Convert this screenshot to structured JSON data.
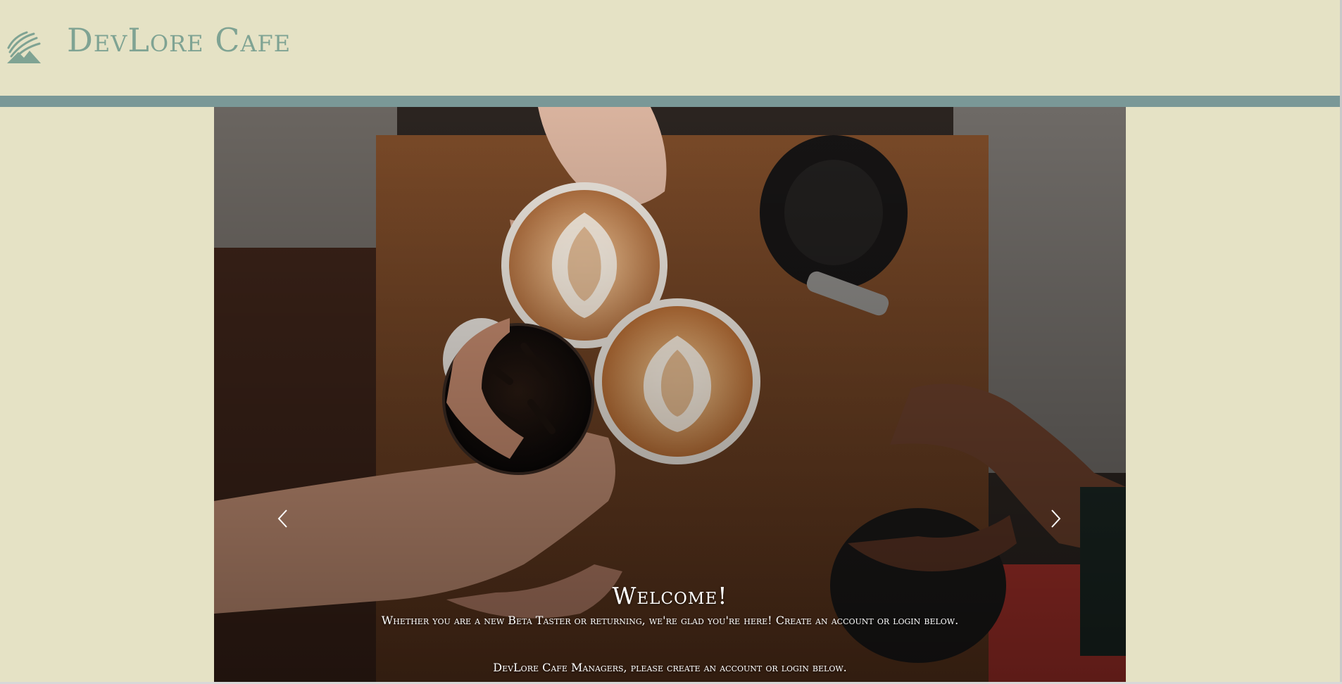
{
  "header": {
    "brand": "DevLore Cafe",
    "logo_icon": "leaf-mountain-logo-icon",
    "brand_color": "#7fa393",
    "rule_color": "#7a9897",
    "background_color": "#e5e2c5"
  },
  "slideshow": {
    "image": "coffee-cups-toast-photo",
    "prev_icon": "chevron-left-icon",
    "next_icon": "chevron-right-icon",
    "title": "Welcome!",
    "line1": "Whether you are a new Beta Taster or returning, we're glad you're here! Create an account or login below.",
    "line2": "DevLore Cafe Managers, please create an account or login below."
  }
}
